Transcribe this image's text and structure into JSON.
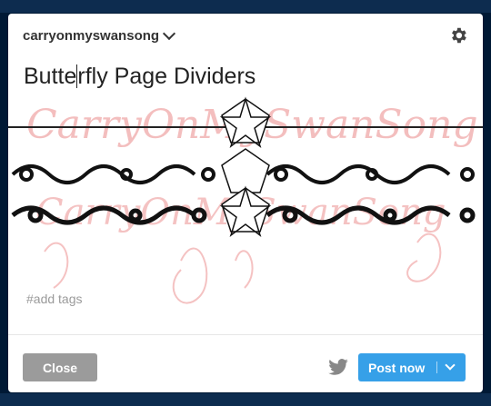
{
  "header": {
    "blog_name": "carryonmyswansong",
    "settings_icon": "gear-icon",
    "dropdown_icon": "chevron-down-icon"
  },
  "post": {
    "title_before_cursor": "Butte",
    "title_after_cursor": "rfly Page Dividers",
    "watermark": "CarryOnMySwanSong"
  },
  "tags": {
    "placeholder": "#add tags"
  },
  "footer": {
    "close_label": "Close",
    "share_icon": "twitter-icon",
    "post_label": "Post now",
    "post_menu_icon": "chevron-down-icon"
  },
  "colors": {
    "post_button": "#36a0e8",
    "close_button": "#9b9b9b",
    "background": "#001935",
    "watermark": "#f2b3b3"
  }
}
